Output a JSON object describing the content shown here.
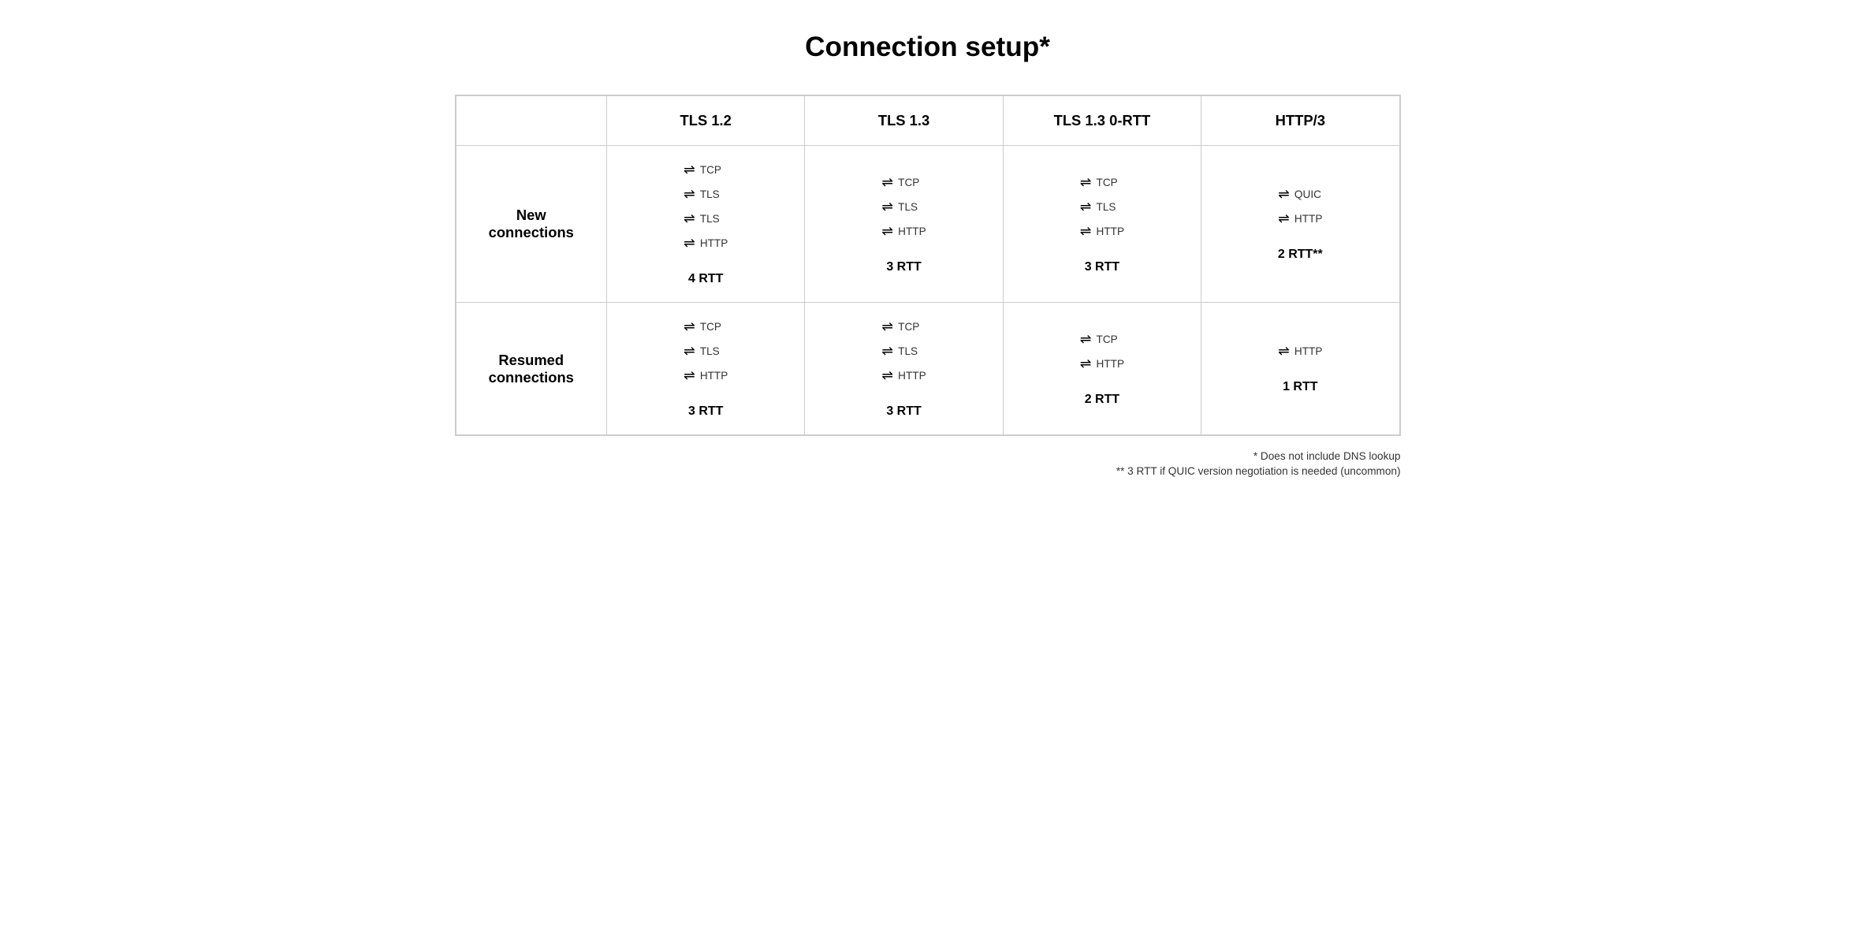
{
  "title": "Connection setup*",
  "columns": [
    "",
    "TLS 1.2",
    "TLS 1.3",
    "TLS 1.3 0-RTT",
    "HTTP/3"
  ],
  "rows": [
    {
      "label": "New\nconnections",
      "cells": [
        {
          "protocols": [
            "TCP",
            "TLS",
            "TLS",
            "HTTP"
          ],
          "rtt": "4 RTT"
        },
        {
          "protocols": [
            "TCP",
            "TLS",
            "HTTP"
          ],
          "rtt": "3 RTT"
        },
        {
          "protocols": [
            "TCP",
            "TLS",
            "HTTP"
          ],
          "rtt": "3 RTT"
        },
        {
          "protocols": [
            "QUIC",
            "HTTP"
          ],
          "rtt": "2 RTT**"
        }
      ]
    },
    {
      "label": "Resumed\nconnections",
      "cells": [
        {
          "protocols": [
            "TCP",
            "TLS",
            "HTTP"
          ],
          "rtt": "3 RTT"
        },
        {
          "protocols": [
            "TCP",
            "TLS",
            "HTTP"
          ],
          "rtt": "3 RTT"
        },
        {
          "protocols": [
            "TCP",
            "HTTP"
          ],
          "rtt": "2 RTT"
        },
        {
          "protocols": [
            "HTTP"
          ],
          "rtt": "1 RTT"
        }
      ]
    }
  ],
  "footnotes": [
    "* Does not include DNS lookup",
    "** 3 RTT if QUIC version negotiation is needed (uncommon)"
  ]
}
